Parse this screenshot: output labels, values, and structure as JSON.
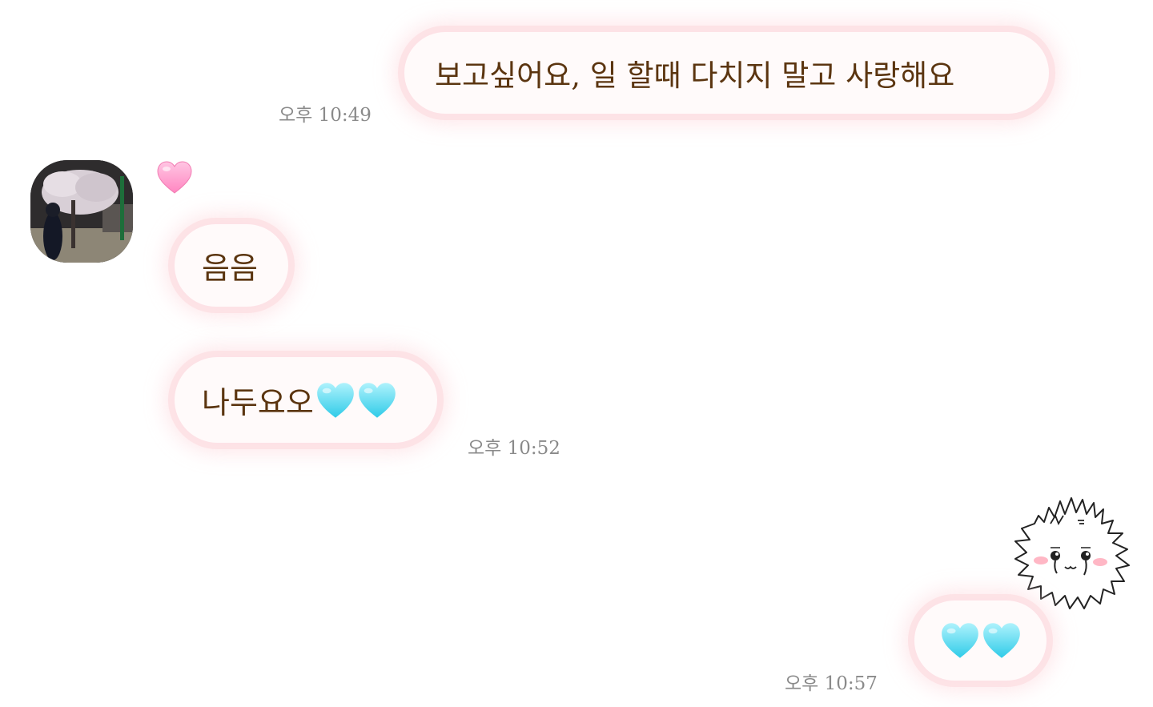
{
  "messages": [
    {
      "id": "m1",
      "direction": "sent",
      "text": "보고싶어요, 일 할때 다치지 말고 사랑해요",
      "time": "오후 10:49"
    },
    {
      "id": "m2",
      "direction": "received",
      "text": "음음",
      "reaction": "pink-heart"
    },
    {
      "id": "m3",
      "direction": "received",
      "text": "나두요오",
      "emoji": [
        "light-blue-heart",
        "light-blue-heart"
      ],
      "time": "오후 10:52"
    },
    {
      "id": "m4",
      "direction": "sent",
      "sticker": "crying-fluffy-creature-sticker",
      "emoji": [
        "light-blue-heart",
        "light-blue-heart"
      ],
      "time": "오후 10:57"
    }
  ],
  "colors": {
    "bubble_glow": "#fde0e4",
    "bubble_fill": "#fffafa",
    "text": "#5b3510",
    "timestamp": "#8a8a8a",
    "pink_heart": "#ff9ccf",
    "light_blue_heart": "#5fdcf2"
  },
  "icons": {
    "reaction": "pink-heart-icon",
    "emoji": "light-blue-heart-icon",
    "avatar": "profile-photo-cherry-blossom-night"
  }
}
